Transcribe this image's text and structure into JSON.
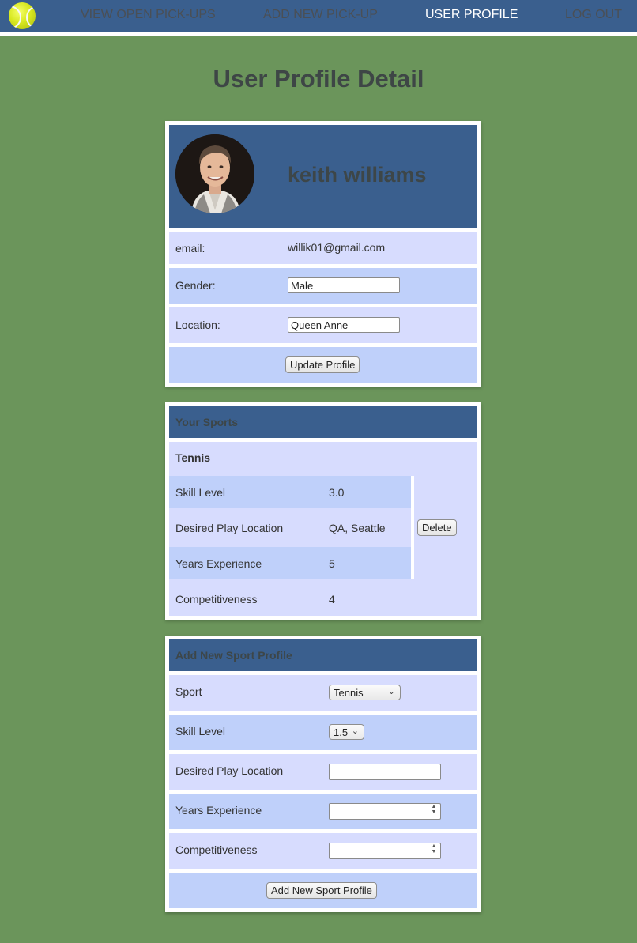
{
  "nav": {
    "logo_icon": "tennis-ball-icon",
    "links": [
      "VIEW OPEN PICK-UPS",
      "ADD NEW PICK-UP",
      "USER PROFILE",
      "LOG OUT"
    ],
    "active": "USER PROFILE"
  },
  "page_title": "User Profile Detail",
  "profile": {
    "name": "keith williams",
    "email_label": "email:",
    "email": "willik01@gmail.com",
    "gender_label": "Gender:",
    "gender": "Male",
    "location_label": "Location:",
    "location": "Queen Anne",
    "update_button": "Update Profile"
  },
  "sports": {
    "header": "Your Sports",
    "sport_name": "Tennis",
    "rows": [
      {
        "label": "Skill Level",
        "value": "3.0"
      },
      {
        "label": "Desired Play Location",
        "value": "QA, Seattle"
      },
      {
        "label": "Years Experience",
        "value": "5"
      },
      {
        "label": "Competitiveness",
        "value": "4"
      }
    ],
    "delete_button": "Delete"
  },
  "add_sport": {
    "header": "Add New Sport Profile",
    "sport_label": "Sport",
    "sport_value": "Tennis",
    "skill_label": "Skill Level",
    "skill_value": "1.5",
    "location_label": "Desired Play Location",
    "location_value": "",
    "years_label": "Years Experience",
    "years_value": "",
    "competitiveness_label": "Competitiveness",
    "competitiveness_value": "",
    "submit_button": "Add New Sport Profile"
  },
  "colors": {
    "background": "#6b955b",
    "nav": "#3a5f8e",
    "row_light": "#d7dcfe",
    "row_mid": "#bfd0fa"
  }
}
